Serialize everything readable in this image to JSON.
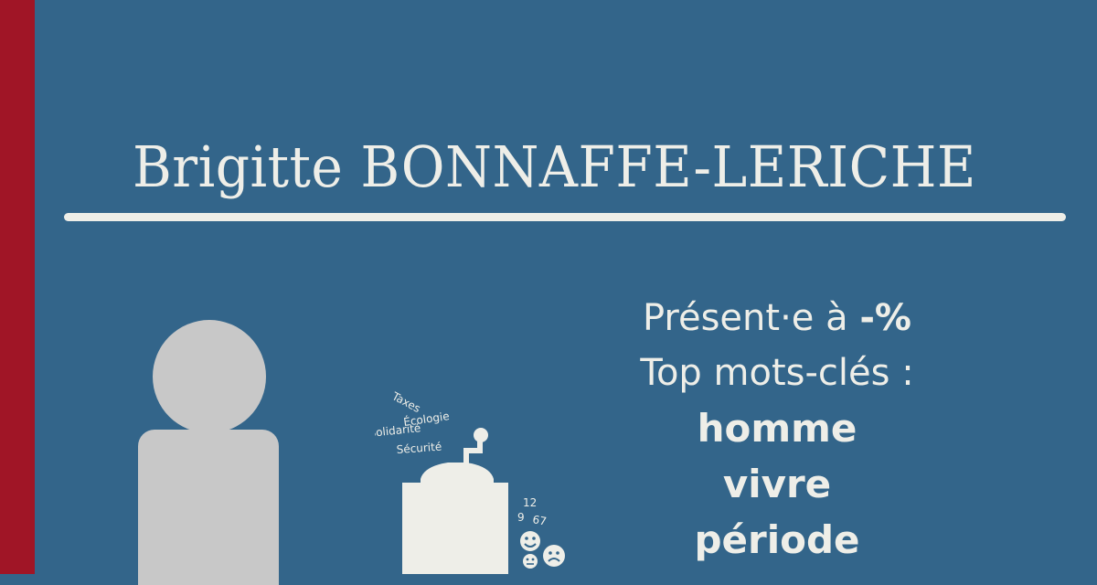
{
  "candidate": {
    "name": "Brigitte BONNAFFE-LERICHE"
  },
  "stats": {
    "presence_prefix": "Présent·e à ",
    "presence_value": "-%",
    "keywords_label": "Top mots-clés :",
    "keywords": [
      "homme",
      "vivre",
      "période"
    ]
  },
  "illustration": {
    "words": [
      "Taxes",
      "Écologie",
      "Solidarité",
      "Sécurité"
    ],
    "numbers": [
      "12",
      "9",
      "67"
    ],
    "icons": [
      "smiley-happy-icon",
      "smiley-neutral-icon",
      "smiley-sad-icon",
      "coffee-grinder-icon",
      "person-silhouette-icon"
    ]
  },
  "colors": {
    "background": "#33658a",
    "accent_band": "#a01526",
    "text": "#eeeee8",
    "silhouette": "#c8c8c8"
  }
}
